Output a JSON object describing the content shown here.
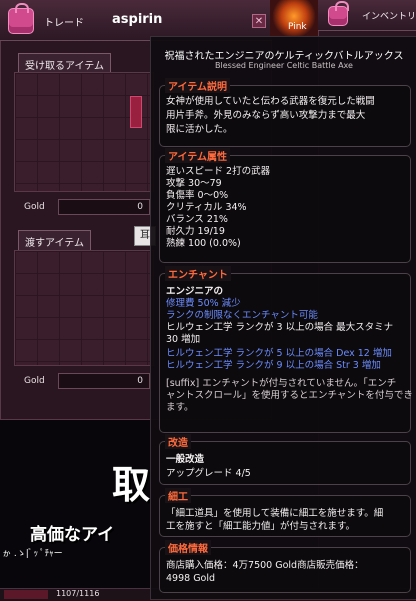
{
  "trade": {
    "title": "トレード",
    "partner": "aspirin",
    "receive_tab": "受け取るアイテム",
    "give_tab": "渡すアイテム",
    "gold_label_1": "Gold",
    "gold_value_1": "0",
    "gold_label_2": "Gold",
    "gold_value_2": "0",
    "right_button_fragment": "耳"
  },
  "inventory": {
    "title": "インベントリ",
    "pink_label": "Pink"
  },
  "bottom": {
    "big_char": "取",
    "big_line": "高価なアイ",
    "small_line": "ゕ .ゝ| ゙ ｯ ﾟﾁｬー",
    "counter": "1107/1116"
  },
  "tooltip": {
    "item_name": "祝福されたエンジニアのケルティックバトルアックス",
    "item_sub": "Blessed Engineer Celtic Battle Axe",
    "description": {
      "title": "アイテム説明",
      "lines": [
        "女神が使用していたと伝わる武器を復元した戦闘",
        "用片手斧。外見のみならず高い攻撃力まで最大",
        "限に活かした。"
      ]
    },
    "attributes": {
      "title": "アイテム属性",
      "lines": [
        "遅いスピード 2打の武器",
        "攻撃 30～79",
        "負傷率 0～0%",
        "クリティカル 34%",
        "バランス 21%",
        "耐久力 19/19",
        "熟練 100 (0.0%)"
      ]
    },
    "enchant": {
      "title": "エンチャント",
      "name": "エンジニアの",
      "line_1": "修理費 50% 減少",
      "line_2": "ランクの制限なくエンチャント可能",
      "line_3a": "ヒルウェン工学 ランクが 3 以上の場合 最大スタミナ",
      "line_3b": "30 増加",
      "line_4": "ヒルウェン工学 ランクが 5 以上の場合 Dex 12 増加",
      "line_5": "ヒルウェン工学 ランクが 9 以上の場合 Str 3 増加",
      "note_1": "[suffix] エンチャントが付与されていません。「エンチ",
      "note_2": "ャントスクロール」を使用するとエンチャントを付与でき",
      "note_3": "ます。"
    },
    "upgrade": {
      "title": "改造",
      "line_1": "一般改造",
      "line_2": "アップグレード 4/5"
    },
    "craft": {
      "title": "細工",
      "line_1": "「細工道具」を使用して装備に細工を施せます。細",
      "line_2": "工を施すと「細工能力値」が付与されます。"
    },
    "price": {
      "title": "価格情報",
      "line_1": "商店購入価格：4万7500 Gold商店販売価格：",
      "line_2": "4998 Gold"
    }
  },
  "colors": {
    "section_title": "#ff6a3c",
    "enchant_blue": "#6b8cff",
    "window_bg": "#2a1620"
  }
}
